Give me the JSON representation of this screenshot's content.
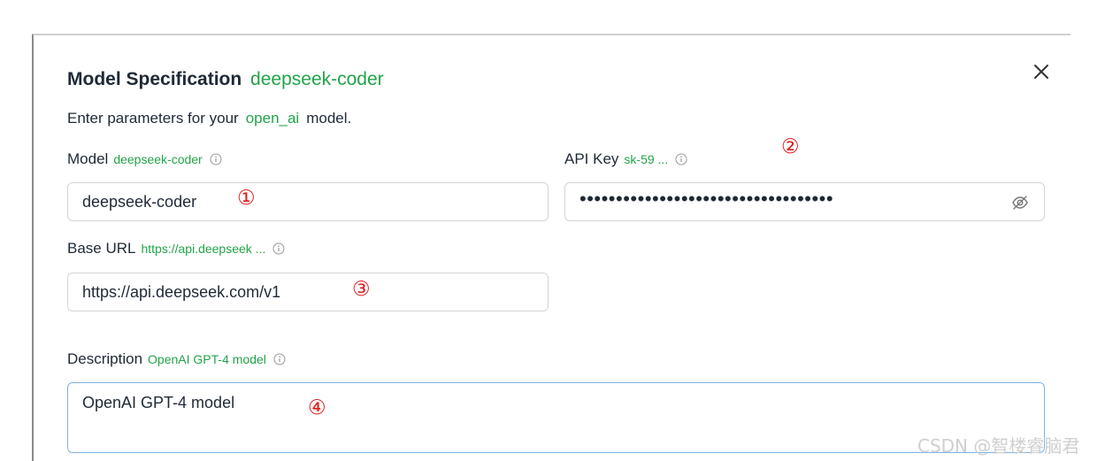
{
  "dialog": {
    "title": "Model Specification",
    "title_model": "deepseek-coder",
    "subtitle_prefix": "Enter parameters for your",
    "subtitle_provider": "open_ai",
    "subtitle_suffix": "model.",
    "close_icon": "close-icon"
  },
  "fields": {
    "model": {
      "label": "Model",
      "hint": "deepseek-coder",
      "value": "deepseek-coder"
    },
    "api_key": {
      "label": "API Key",
      "hint": "sk-59 ...",
      "value_masked": "•••••••••••••••••••••••••••••••••••",
      "toggle_icon": "eye-off-icon"
    },
    "base_url": {
      "label": "Base URL",
      "hint": "https://api.deepseek ...",
      "value": "https://api.deepseek.com/v1"
    },
    "description": {
      "label": "Description",
      "hint": "OpenAI GPT-4 model",
      "value": "OpenAI GPT-4 model"
    }
  },
  "annotations": {
    "marker_1": "①",
    "marker_2": "②",
    "marker_3": "③",
    "marker_4": "④"
  },
  "watermark": "CSDN @智楼睿脑君",
  "colors": {
    "accent": "#22a34a",
    "marker": "#e01b1b",
    "focus_border": "#7fb3e6"
  }
}
